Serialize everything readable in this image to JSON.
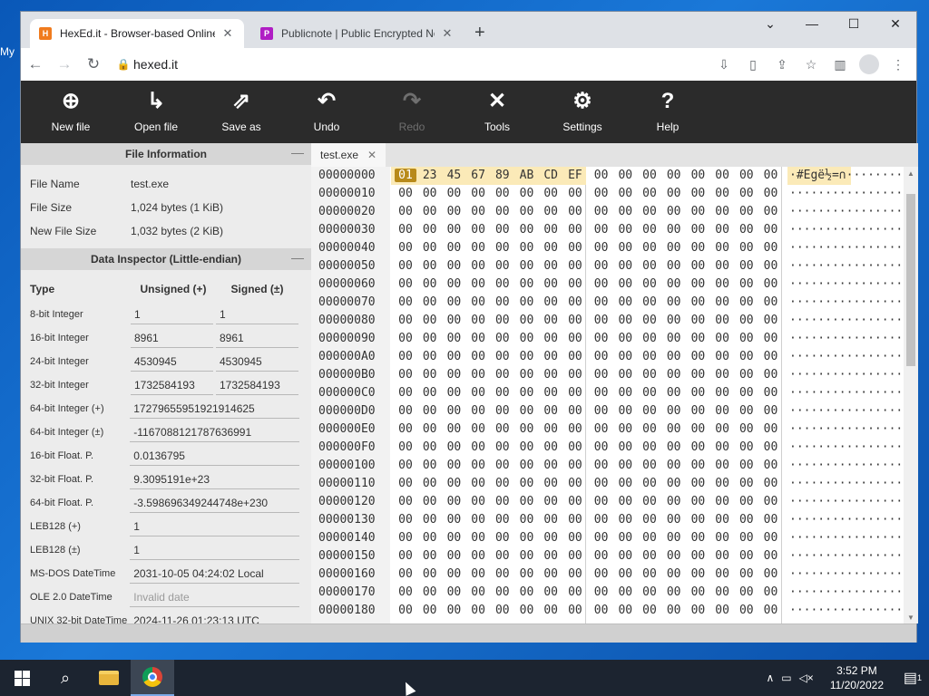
{
  "desktop": {
    "icon_label": "My"
  },
  "browser": {
    "tabs": [
      {
        "title": "HexEd.it - Browser-based Online",
        "favicon": "hexed-favicon",
        "color": "#f07b1e",
        "glyph": "H",
        "active": true
      },
      {
        "title": "Publicnote | Public Encrypted No",
        "favicon": "publicnote-favicon",
        "color": "#b01dc4",
        "glyph": "P",
        "active": false
      }
    ],
    "url": "hexed.it"
  },
  "app": {
    "toolbar": [
      {
        "label": "New file",
        "icon": "new-file-icon",
        "enabled": true
      },
      {
        "label": "Open file",
        "icon": "open-file-icon",
        "enabled": true
      },
      {
        "label": "Save as",
        "icon": "save-as-icon",
        "enabled": true
      },
      {
        "label": "Undo",
        "icon": "undo-icon",
        "enabled": true
      },
      {
        "label": "Redo",
        "icon": "redo-icon",
        "enabled": false
      },
      {
        "label": "Tools",
        "icon": "tools-icon",
        "enabled": true
      },
      {
        "label": "Settings",
        "icon": "gear-icon",
        "enabled": true
      },
      {
        "label": "Help",
        "icon": "help-icon",
        "enabled": true
      }
    ],
    "file_info": {
      "title": "File Information",
      "rows": [
        {
          "key": "File Name",
          "value": "test.exe"
        },
        {
          "key": "File Size",
          "value": "1,024 bytes (1 KiB)"
        },
        {
          "key": "New File Size",
          "value": "1,032 bytes (2 KiB)"
        }
      ]
    },
    "inspector": {
      "title": "Data Inspector (Little-endian)",
      "headers": {
        "type": "Type",
        "unsigned": "Unsigned (+)",
        "signed": "Signed (±)"
      },
      "rows": [
        {
          "type": "8-bit Integer",
          "unsigned": "1",
          "signed": "1"
        },
        {
          "type": "16-bit Integer",
          "unsigned": "8961",
          "signed": "8961"
        },
        {
          "type": "24-bit Integer",
          "unsigned": "4530945",
          "signed": "4530945"
        },
        {
          "type": "32-bit Integer",
          "unsigned": "1732584193",
          "signed": "1732584193"
        },
        {
          "type": "64-bit Integer (+)",
          "value": "17279655951921914625"
        },
        {
          "type": "64-bit Integer (±)",
          "value": "-1167088121787636991"
        },
        {
          "type": "16-bit Float. P.",
          "value": "0.0136795"
        },
        {
          "type": "32-bit Float. P.",
          "value": "9.3095191e+23"
        },
        {
          "type": "64-bit Float. P.",
          "value": "-3.598696349244748e+230"
        },
        {
          "type": "LEB128 (+)",
          "value": "1"
        },
        {
          "type": "LEB128 (±)",
          "value": "1"
        },
        {
          "type": "MS-DOS DateTime",
          "value": "2031-10-05 04:24:02 Local"
        },
        {
          "type": "OLE 2.0 DateTime",
          "value": "Invalid date",
          "placeholder": true
        },
        {
          "type": "UNIX 32-bit DateTime",
          "value": "2024-11-26 01:23:13 UTC"
        }
      ]
    },
    "file_tab": "test.exe",
    "hex": {
      "first_row": [
        "01",
        "23",
        "45",
        "67",
        "89",
        "AB",
        "CD",
        "EF",
        "00",
        "00",
        "00",
        "00",
        "00",
        "00",
        "00",
        "00"
      ],
      "first_ascii": "·#Egë½=∩········",
      "offsets": [
        "00000000",
        "00000010",
        "00000020",
        "00000030",
        "00000040",
        "00000050",
        "00000060",
        "00000070",
        "00000080",
        "00000090",
        "000000A0",
        "000000B0",
        "000000C0",
        "000000D0",
        "000000E0",
        "000000F0",
        "00000100",
        "00000110",
        "00000120",
        "00000130",
        "00000140",
        "00000150",
        "00000160",
        "00000170",
        "00000180"
      ],
      "fill_byte": "00",
      "fill_ascii": "················",
      "selected_index": 0,
      "selected_color": "#b88a1a",
      "highlight_color": "#fbeab8"
    }
  },
  "taskbar": {
    "items": [
      {
        "name": "start-button",
        "icon": "windows-icon"
      },
      {
        "name": "search-button",
        "icon": "search-icon"
      },
      {
        "name": "file-explorer",
        "icon": "folder-icon"
      },
      {
        "name": "chrome",
        "icon": "chrome-icon",
        "active": true
      }
    ],
    "time": "3:52 PM",
    "date": "11/20/2022",
    "notification_count": "1"
  }
}
